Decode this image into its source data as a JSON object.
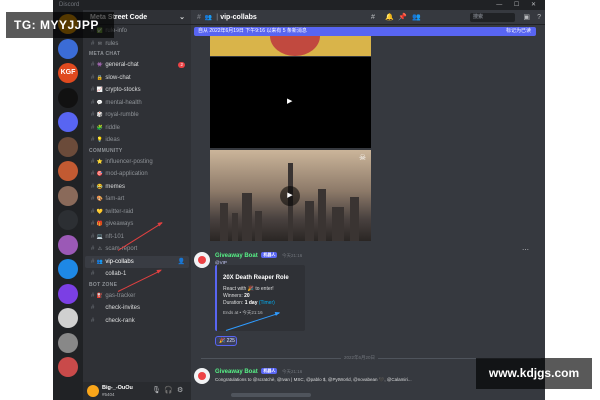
{
  "window": {
    "title": "Discord",
    "controls": "— ☐ ✕"
  },
  "server": {
    "name": "Meta Street Code"
  },
  "guilds": [
    {
      "label": "",
      "color": "#f0a000"
    },
    {
      "label": "",
      "color": "#3b6cd6"
    },
    {
      "label": "KGF",
      "color": "#e04a1f"
    },
    {
      "label": "",
      "color": "#111111"
    },
    {
      "label": "",
      "color": "#5865f2"
    },
    {
      "label": "",
      "color": "#6b4b3a"
    },
    {
      "label": "",
      "color": "#c25a32"
    },
    {
      "label": "",
      "color": "#8a6a5a"
    },
    {
      "label": "",
      "color": "#2c2f33"
    },
    {
      "label": "",
      "color": "#9b59b6"
    },
    {
      "label": "",
      "color": "#1e88e5"
    },
    {
      "label": "",
      "color": "#7b3fe4"
    },
    {
      "label": "",
      "color": "#d0d0d0"
    },
    {
      "label": "",
      "color": "#888888"
    },
    {
      "label": "",
      "color": "#c94a4a"
    }
  ],
  "guild_badges": [
    "",
    "",
    "",
    "",
    "",
    "",
    "",
    "",
    "",
    "",
    "",
    "",
    "",
    "",
    "46"
  ],
  "channels": {
    "top": [
      {
        "emoji": "✅",
        "name": "rule-info"
      },
      {
        "emoji": "✉",
        "name": "rules"
      }
    ],
    "cat_chat": "META CHAT",
    "chat": [
      {
        "emoji": "👾",
        "name": "general-chat",
        "badge": "2"
      },
      {
        "emoji": "🔒",
        "name": "slow-chat"
      },
      {
        "emoji": "📈",
        "name": "crypto-stocks"
      },
      {
        "emoji": "💬",
        "name": "mental-health"
      },
      {
        "emoji": "🎲",
        "name": "royal-rumble"
      },
      {
        "emoji": "🧩",
        "name": "riddle"
      },
      {
        "emoji": "💡",
        "name": "ideas"
      }
    ],
    "cat_community": "COMMUNITY",
    "community": [
      {
        "emoji": "⭐",
        "name": "influencer-posting"
      },
      {
        "emoji": "🎯",
        "name": "mod-application"
      },
      {
        "emoji": "😂",
        "name": "memes"
      },
      {
        "emoji": "🎨",
        "name": "fam-art"
      },
      {
        "emoji": "💛",
        "name": "twitter-raid"
      },
      {
        "emoji": "🎁",
        "name": "giveaways"
      },
      {
        "emoji": "💻",
        "name": "nft-101"
      },
      {
        "emoji": "⚠",
        "name": "scam-report"
      },
      {
        "emoji": "👥",
        "name": "vip-collabs"
      },
      {
        "emoji": "",
        "name": "collab-1"
      }
    ],
    "cat_bot": "BOT ZONE",
    "bot": [
      {
        "emoji": "⛽",
        "name": "gas-tracker"
      },
      {
        "emoji": "",
        "name": "check-invites"
      },
      {
        "emoji": "",
        "name": "check-rank"
      }
    ]
  },
  "user": {
    "name": "Big-_-OuOu",
    "tag": "#5404"
  },
  "channel_header": {
    "name": "vip-collabs",
    "search_placeholder": "搜索"
  },
  "new_messages_bar": {
    "text": "自从 2022年6月19日 下午9:16 以来有 5 条新消息",
    "mark": "标记为已读"
  },
  "message1": {
    "author": "Giveaway Boat",
    "bot_label": "机器人",
    "time": "今天21:16",
    "role_ping": "@VIP",
    "embed": {
      "title": "20X Death Reaper Role",
      "react_line": "React with 🎉 to enter!",
      "winners_label": "Winners:",
      "winners": "20",
      "duration_label": "Duration:",
      "duration": "1 day",
      "duration_link": "(Timer)",
      "ends_at": "Ends at • 今天21:16"
    },
    "reaction": "🎉 225"
  },
  "date_divider": "2022年6月20日",
  "message2": {
    "author": "Giveaway Boat",
    "bot_label": "机器人",
    "time": "今天21:16",
    "text": "Congratulations to @scratchè, @Ivan | MSC, @pablo $, @PytWorld, @novabean 🖤, @Calamiri..."
  },
  "watermarks": {
    "left": "TG: MYYJJPP",
    "right": "www.kdjgs.com"
  },
  "colors": {
    "accent": "#5865f2",
    "bot_name": "#57f287",
    "unread_badge": "#ed4245"
  }
}
